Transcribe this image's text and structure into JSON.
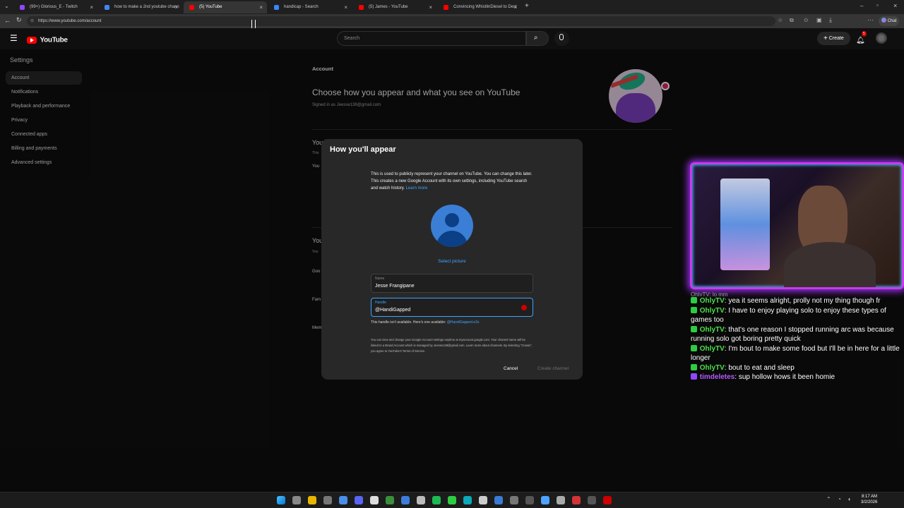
{
  "browser": {
    "tabs": [
      {
        "label": "(99+) Glorious_E - Twitch",
        "color": "#9146ff"
      },
      {
        "label": "how to make a 2nd youtube chann",
        "color": "#4285f4"
      },
      {
        "label": "(5) YouTube",
        "color": "#ff0000",
        "active": true
      },
      {
        "label": "handicap - Search",
        "color": "#3a86ff"
      },
      {
        "label": "(5) James - YouTube",
        "color": "#ff0000"
      },
      {
        "label": "Convincing WhistlinDiesel to Dest",
        "color": "#ff0000"
      }
    ],
    "close_glyph": "×",
    "new_tab_glyph": "+",
    "url": "https://www.youtube.com/account",
    "chat_button": "Chat",
    "window_controls": [
      "–",
      "▫",
      "×"
    ]
  },
  "youtube": {
    "logo_text": "YouTube",
    "search_placeholder": "Search",
    "create_label": "Create",
    "notification_count": "5"
  },
  "sidebar": {
    "heading": "Settings",
    "items": [
      {
        "label": "Account",
        "active": true
      },
      {
        "label": "Notifications"
      },
      {
        "label": "Playback and performance"
      },
      {
        "label": "Privacy"
      },
      {
        "label": "Connected apps"
      },
      {
        "label": "Billing and payments"
      },
      {
        "label": "Advanced settings"
      }
    ]
  },
  "settings_page": {
    "section_label": "Account",
    "title": "Choose how you appear and what you see on YouTube",
    "signed_in": "Signed in as Jeesse138@gmail.com",
    "partial_labels": [
      "You",
      "This",
      "You",
      "You",
      "You",
      "Goo",
      "Fam",
      "Mem"
    ]
  },
  "modal": {
    "title": "How you'll appear",
    "description": "This is used to publicly represent your channel on YouTube. You can change this later. This creates a new Google Account with its own settings, including YouTube search and watch history.",
    "learn_more": "Learn more",
    "select_picture": "Select picture",
    "name_label": "Name",
    "name_value": "Jesse Frangipane",
    "handle_label": "Handle",
    "handle_value": "@HandiGapped",
    "handle_hint": "This handle isn't available. Here's one available:",
    "handle_suggestion": "@HandiGapped-e2s",
    "fineprint": "You can view and change your Google Account settings anytime at myaccount.google.com. Your channel name will be linked to a Brand Account which is managed by Jeesse138@gmail.com. Learn more about channels. By selecting \"Create\", you agree to YouTube's Terms of Service.",
    "cancel_label": "Cancel",
    "create_label": "Create channel"
  },
  "chat": {
    "top_partial": "ОhlyTV: lo mm",
    "messages": [
      {
        "user": "OhlyTV",
        "text": "yea it seems alright, prolly not my thing though fr"
      },
      {
        "user": "OhlyTV",
        "text": "I have to enjoy playing solo to enjoy these types of games too"
      },
      {
        "user": "OhlyTV",
        "text": "that's one reason I stopped running arc was because running solo got boring pretty quick"
      },
      {
        "user": "OhlyTV",
        "text": "I'm bout to make some food but I'll be in here for a little longer"
      },
      {
        "user": "OhlyTV",
        "text": "bout to eat and sleep"
      },
      {
        "user": "timdeletes",
        "text": "sup hollow hows it been homie",
        "purple": true
      }
    ]
  },
  "taskbar": {
    "time": "8:17 AM",
    "date": "3/2/2026"
  },
  "colors": {
    "accent_blue": "#3ea6ff",
    "yt_red": "#ff0000",
    "chat_green": "#4ce04c",
    "cam_border": "#c63cf0"
  }
}
